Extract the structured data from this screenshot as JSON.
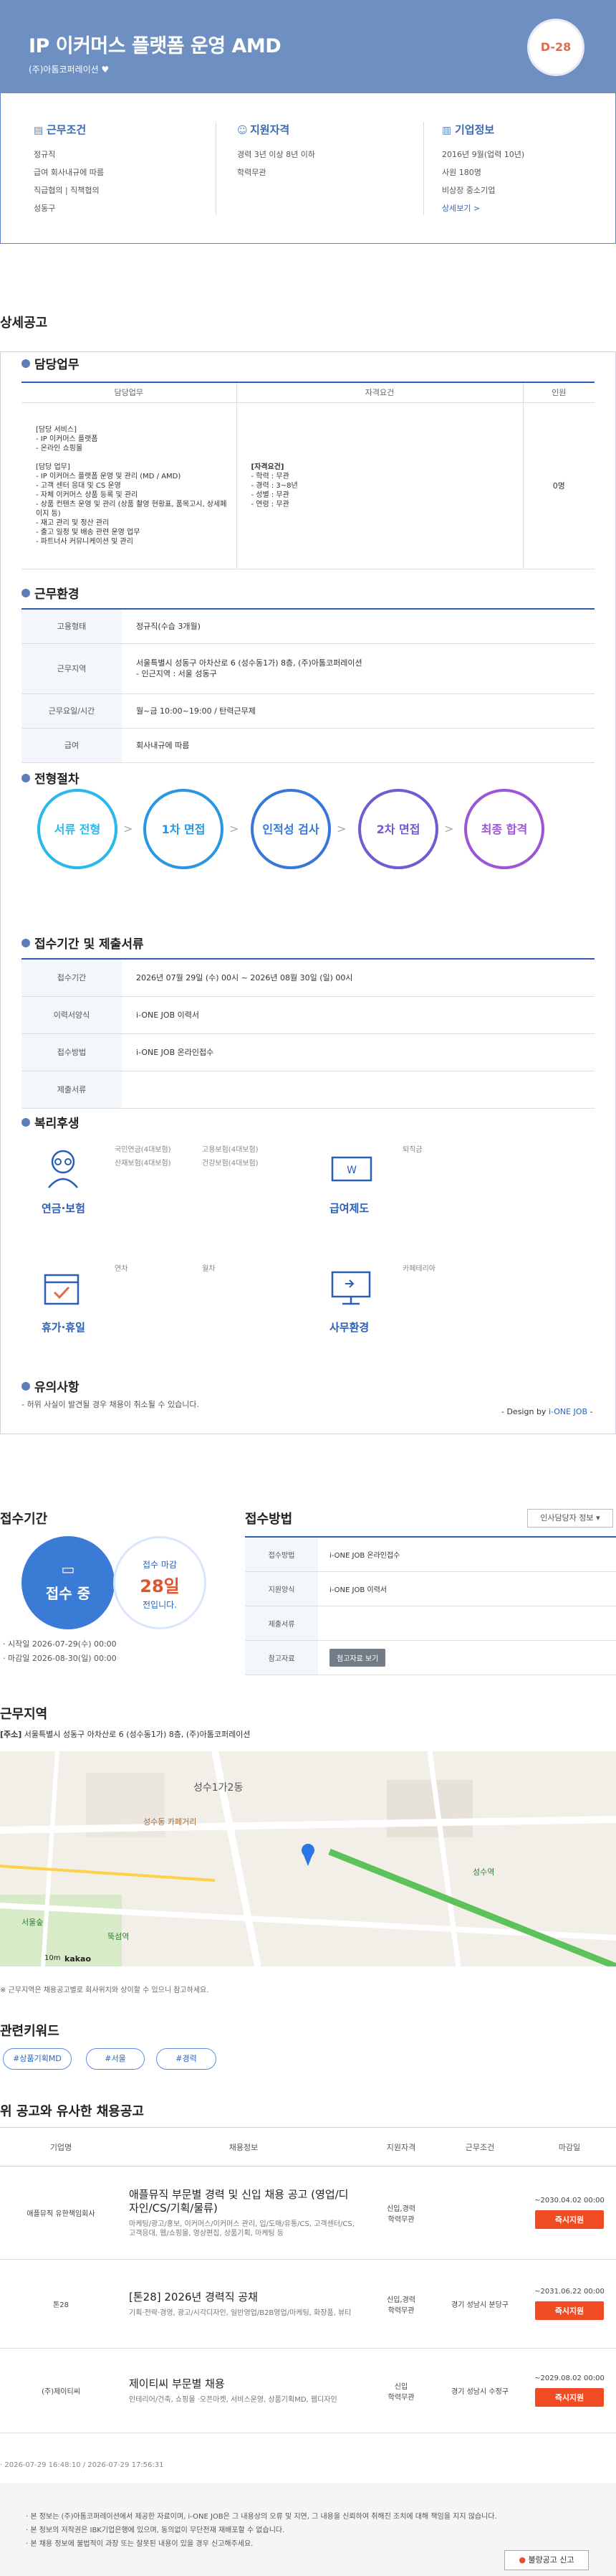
{
  "header": {
    "title": "IP 이커머스 플랫폼 운영 AMD",
    "company": "(주)아톰코퍼레이션",
    "dday": "D-28"
  },
  "summary": {
    "conditions": {
      "title": "근무조건",
      "items": [
        "정규직",
        "급여 회사내규에 따름",
        "직급협의 | 직책협의",
        "성동구"
      ]
    },
    "qualifications": {
      "title": "지원자격",
      "items": [
        "경력 3년 이상 8년 이하",
        "학력무관"
      ]
    },
    "company": {
      "title": "기업정보",
      "items": [
        "2016년 9월(업력 10년)",
        "사원 180명",
        "비상장 중소기업"
      ],
      "more": "상세보기 >"
    }
  },
  "detail": {
    "heading": "상세공고",
    "duties": {
      "title": "담당업무",
      "headers": [
        "담당업무",
        "자격요건",
        "인원"
      ],
      "duty_lines": [
        "[담당 서비스]",
        "- IP 이커머스 플랫폼",
        "- 온라인 쇼핑몰",
        "",
        "[담당 업무]",
        "- IP 이커머스 플랫폼 운영 및 관리 (MD / AMD)",
        "- 고객 센터 응대 및 CS 운영",
        "- 자체 이커머스 상품 등록 및 관리",
        "- 상품 컨텐츠 운영 및 관리 (상품 촬영 현황표, 품목고시, 상세페이지 등)",
        "- 재고 관리 및 정산 관리",
        "- 출고 일정 및 배송 관련 운영 업무",
        "- 파트너사 커뮤니케이션 및 관리"
      ],
      "qual_lines": [
        "[자격요건]",
        "- 학력 : 무관",
        "- 경력 : 3~8년",
        "- 성별 : 무관",
        "- 연령 : 무관"
      ],
      "count": "0명"
    },
    "environment": {
      "title": "근무환경",
      "rows": [
        {
          "label": "고용형태",
          "value": "정규직(수습 3개월)"
        },
        {
          "label": "근무지역",
          "value": "서울특별시 성동구 아차산로 6 (성수동1가) 8층, (주)아톰코퍼레이션\n- 인근지역 : 서울 성동구"
        },
        {
          "label": "근무요일/시간",
          "value": "월~금 10:00~19:00 / 탄력근무제"
        },
        {
          "label": "급여",
          "value": "회사내규에 따름"
        }
      ]
    },
    "process": {
      "title": "전형절차",
      "steps": [
        "서류 전형",
        "1차 면접",
        "인적성 검사",
        "2차 면접",
        "최종 합격"
      ],
      "arrow": ">",
      "colors": [
        "#28b8ea",
        "#2a95e3",
        "#3877da",
        "#7459d0",
        "#9b55d6"
      ]
    },
    "submission": {
      "title": "접수기간 및 제출서류",
      "rows": [
        {
          "label": "접수기간",
          "value": "2026년 07월 29일 (수) 00시 ~ 2026년 08월 30일 (일) 00시"
        },
        {
          "label": "이력서양식",
          "value": "i-ONE JOB 이력서"
        },
        {
          "label": "접수방법",
          "value": "i-ONE JOB 온라인접수"
        },
        {
          "label": "제출서류",
          "value": ""
        }
      ]
    },
    "welfare": {
      "title": "복리후생",
      "groups": [
        {
          "label": "연금·보험",
          "icon": "insurance-icon",
          "items": [
            "국민연금(4대보험)",
            "산재보험(4대보험)",
            "고용보험(4대보험)",
            "건강보험(4대보험)"
          ]
        },
        {
          "label": "급여제도",
          "icon": "salary-icon",
          "items": [
            "퇴직금"
          ]
        },
        {
          "label": "휴가·휴일",
          "icon": "calendar-icon",
          "items": [
            "연차",
            "월차"
          ]
        },
        {
          "label": "사무환경",
          "icon": "monitor-icon",
          "items": [
            "카페테리아"
          ]
        }
      ]
    },
    "caution": {
      "title": "유의사항",
      "text": "- 허위 사실이 발견될 경우 채용이 취소될 수 있습니다."
    },
    "design_by": {
      "prefix": "- Design by ",
      "brand": "i-ONE JOB",
      "suffix": " -"
    }
  },
  "period": {
    "title": "접수기간",
    "status": "접수 중",
    "deadline_label": "접수 마감",
    "days": "28일",
    "remain": "전입니다.",
    "start": "· 시작일 2026-07-29(수) 00:00",
    "end": "· 마감일 2026-08-30(일) 00:00"
  },
  "method": {
    "title": "접수방법",
    "contact_button": "인사담당자 정보",
    "rows": [
      {
        "label": "접수방법",
        "value": "i-ONE JOB 온라인접수"
      },
      {
        "label": "지원양식",
        "value": "i-ONE JOB 이력서"
      },
      {
        "label": "제출서류",
        "value": ""
      },
      {
        "label": "참고자료",
        "value": "첨고자료 보기"
      }
    ]
  },
  "location": {
    "title": "근무지역",
    "address_tag": "[주소]",
    "address": "서울특별시 성동구 아차산로 6 (성수동1가) 8층, (주)아톰코퍼레이션",
    "note": "※ 근무지역은 채용공고별로 회사위치와 상이할 수 있으니 참고하세요.",
    "map_labels": [
      "성수1가2동",
      "성수역",
      "뚝섬역",
      "성수동 카페거리",
      "서울숲",
      "kakao",
      "10m"
    ]
  },
  "keywords": {
    "title": "관련키워드",
    "items": [
      "#상품기획MD",
      "#서울",
      "#경력"
    ]
  },
  "similar": {
    "title": "위 공고와 유사한 채용공고",
    "headers": [
      "기업명",
      "채용정보",
      "지원자격",
      "근무조건",
      "마감일"
    ],
    "rows": [
      {
        "company": "애플뮤직 유한책임회사",
        "title": "애플뮤직 부문별 경력 및 신입 채용 공고 (영업/디자인/CS/기획/물류)",
        "desc": "마케팅/광고/홍보, 이커머스/이커머스 관리, 입/도매/유통/CS, 고객센터/CS, 고객응대, 웹/쇼핑몰, 영상편집, 상품기획, 마케팅 등",
        "qual": "신입,경력\n학력무관",
        "cond": "",
        "deadline": "~2030.04.02 00:00",
        "apply": "즉시지원"
      },
      {
        "company": "톤28",
        "title": "[톤28] 2026년 경력직 공채",
        "desc": "기획·전략·경영, 광고/시각디자인, 일반영업/B2B영업/마케팅, 화장품, 뷰티",
        "qual": "신입,경력\n학력무관",
        "cond": "경기 성남시 분당구",
        "deadline": "~2031.06.22 00:00",
        "apply": "즉시지원"
      },
      {
        "company": "(주)제이티씨",
        "title": "제이티씨 부문별 채용",
        "desc": "인테리어/건축, 쇼핑몰 ·오픈마켓, 서비스운영, 상품기획MD, 웹디자인",
        "qual": "신입\n학력무관",
        "cond": "경기 성남시 수정구",
        "deadline": "~2029.08.02 00:00",
        "apply": "즉시지원"
      }
    ]
  },
  "timestamps": "· 2026-07-29 16:48:10 / 2026-07-29 17:56:31",
  "footer": {
    "notes": [
      "· 본 정보는 (주)아톰코퍼레이션에서 제공한 자료이며, i-ONE JOB은 그 내용상의 오류 및 지연, 그 내용을 신뢰하여 취해진 조치에 대해 책임을 지지 않습니다.",
      "· 본 정보의 저작권은 IBK기업은행에 있으며, 동의없이 무단전재 재배포할 수 없습니다.",
      "· 본 채용 정보에 불법적이 과장 또는 잘못된 내용이 있을 경우 신고해주세요."
    ],
    "report": "불량공고 신고"
  }
}
